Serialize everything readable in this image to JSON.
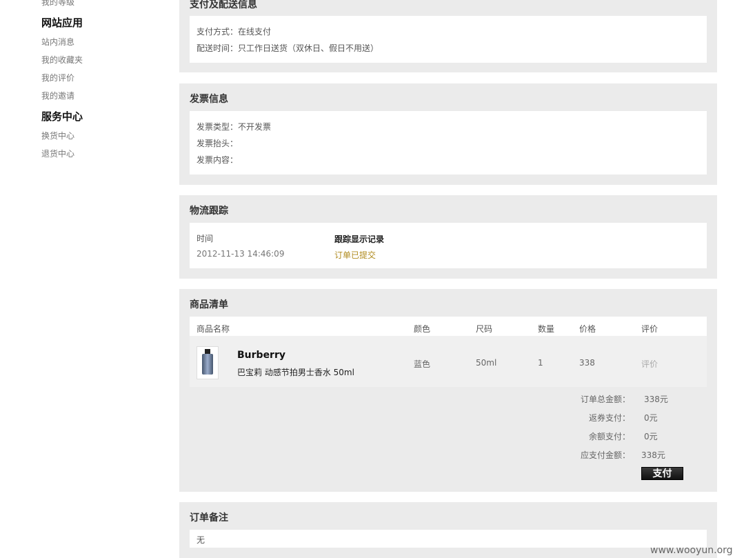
{
  "sidebar": {
    "top_partial": "我的等级",
    "section_app": "网站应用",
    "app_items": [
      "站内消息",
      "我的收藏夹",
      "我的评价",
      "我的邀请"
    ],
    "section_service": "服务中心",
    "service_items": [
      "换货中心",
      "退货中心"
    ]
  },
  "payment": {
    "title": "支付及配送信息",
    "method_label": "支付方式：",
    "method_value": "在线支付",
    "time_label": "配送时间：",
    "time_value": "只工作日送货（双休日、假日不用送）"
  },
  "invoice": {
    "title": "发票信息",
    "type_label": "发票类型：",
    "type_value": "不开发票",
    "header_label": "发票抬头：",
    "content_label": "发票内容："
  },
  "logistics": {
    "title": "物流跟踪",
    "col_time": "时间",
    "col_record": "跟踪显示记录",
    "time": "2012-11-13 14:46:09",
    "status": "订单已提交"
  },
  "goods": {
    "title": "商品清单",
    "headers": {
      "name": "商品名称",
      "color": "颜色",
      "size": "尺码",
      "qty": "数量",
      "price": "价格",
      "review": "评价"
    },
    "item": {
      "brand": "Burberry",
      "name": "巴宝莉 动感节拍男士香水 50ml",
      "color": "蓝色",
      "size": "50ml",
      "qty": "1",
      "price": "338",
      "review": "评价"
    },
    "summary": {
      "total_label": "订单总金额：",
      "total_value": "338元",
      "coupon_label": "返券支付：",
      "coupon_value": "0元",
      "balance_label": "余额支付：",
      "balance_value": "0元",
      "due_label": "应支付金额：",
      "due_value": "338元"
    },
    "pay_button": "支付"
  },
  "remark": {
    "title": "订单备注",
    "value": "无"
  },
  "watermark": "www.wooyun.org"
}
